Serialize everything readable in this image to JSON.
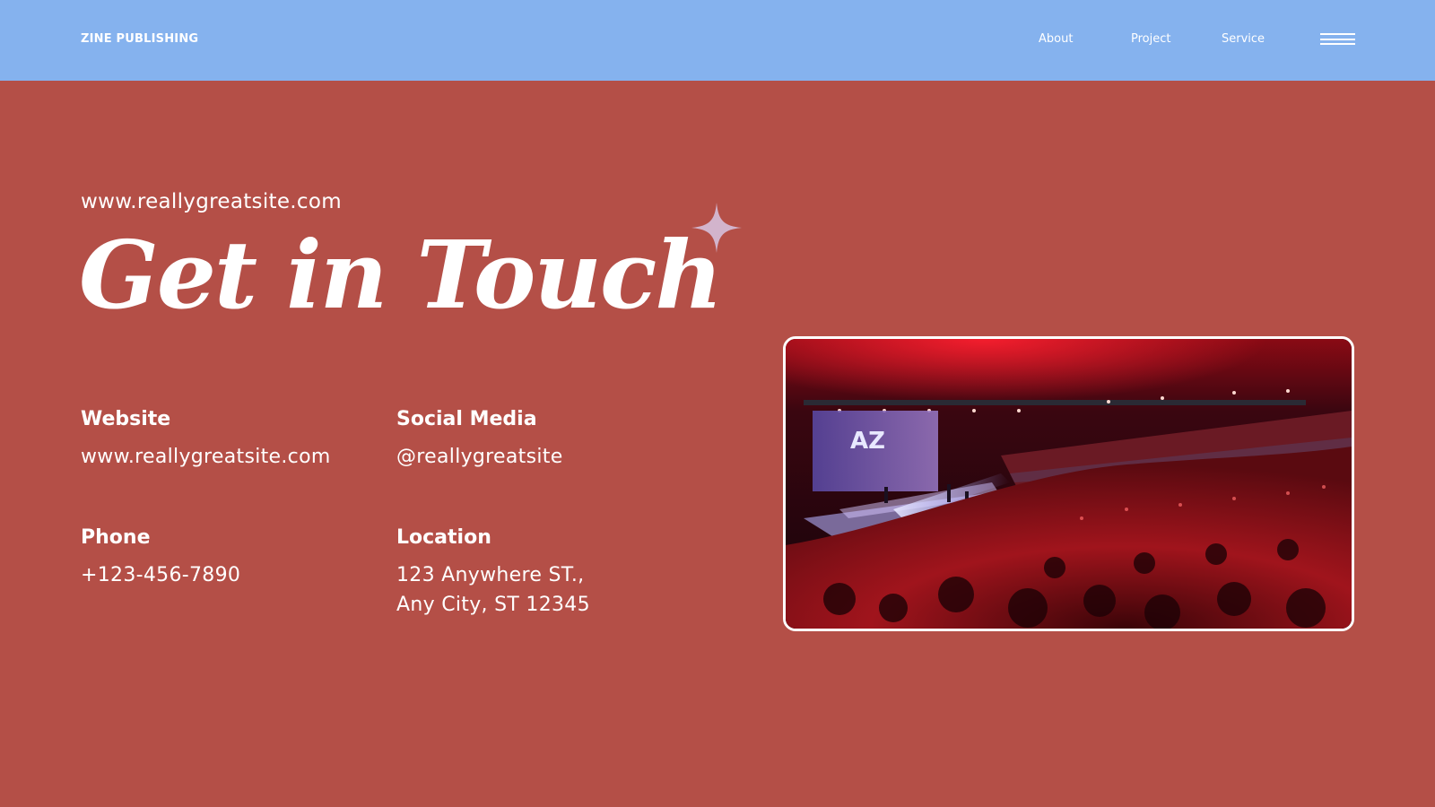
{
  "header": {
    "brand": "ZINE PUBLISHING",
    "nav": [
      {
        "label": "About"
      },
      {
        "label": "Project"
      },
      {
        "label": "Service"
      }
    ],
    "menu_icon": "hamburger-menu-icon",
    "background_color": "#85b2ee"
  },
  "hero": {
    "url": "www.reallygreatsite.com",
    "title": "Get in Touch",
    "decoration_icon": "four-point-star-icon",
    "decoration_color": "#d2b4cc"
  },
  "contact": {
    "website": {
      "label": "Website",
      "value": "www.reallygreatsite.com"
    },
    "social": {
      "label": "Social Media",
      "value": "@reallygreatsite"
    },
    "phone": {
      "label": "Phone",
      "value": "+123-456-7890"
    },
    "location": {
      "label": "Location",
      "line1": "123 Anywhere ST.,",
      "line2": "Any City, ST 12345"
    }
  },
  "photo": {
    "subject": "concert-crowd-photo",
    "stage_sign": "AZ"
  },
  "colors": {
    "page_background": "#b44f47",
    "text": "#ffffff"
  }
}
